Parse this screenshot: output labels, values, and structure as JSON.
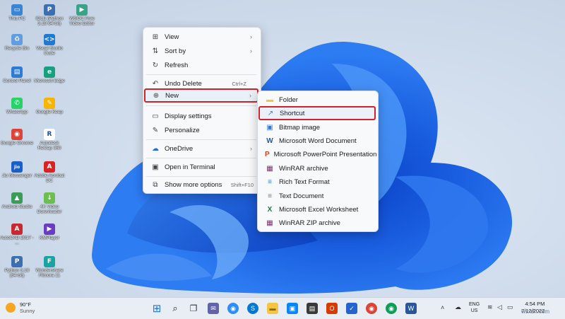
{
  "desktop_icons": [
    {
      "name": "this-pc",
      "label": "This PC",
      "color": "#3a86d6",
      "glyph": "▭"
    },
    {
      "name": "idle-python",
      "label": "IDLE (Python 3.10 64-bit)",
      "color": "#3b6fb0",
      "glyph": "P"
    },
    {
      "name": "wsoc-free-video",
      "label": "WSOC Free Video Editor",
      "color": "#3aa387",
      "glyph": "▶"
    },
    {
      "name": "recycle-bin",
      "label": "Recycle Bin",
      "color": "#5f9ee0",
      "glyph": "♻"
    },
    {
      "name": "visual-studio-code",
      "label": "Visual Studio Code",
      "color": "#1f7ad1",
      "glyph": "<>"
    },
    {
      "name": "control-panel",
      "label": "Control Panel",
      "color": "#2d7bd3",
      "glyph": "▤"
    },
    {
      "name": "microsoft-edge",
      "label": "Microsoft Edge",
      "color": "#17a07c",
      "glyph": "e"
    },
    {
      "name": "whatsapp",
      "label": "WhatsApp",
      "color": "#25d366",
      "glyph": "✆"
    },
    {
      "name": "google-keep",
      "label": "Google Keep",
      "color": "#f7b500",
      "glyph": "✎"
    },
    {
      "name": "google-chrome",
      "label": "Google Chrome",
      "color": "#db4437",
      "glyph": "◉"
    },
    {
      "name": "autodesk-recap",
      "label": "Autodesk ReCap 360",
      "color": "#ffffff",
      "glyph": "R"
    },
    {
      "name": "jio-messenger",
      "label": "Jio Messenger",
      "color": "#1a5fc8",
      "glyph": "jio"
    },
    {
      "name": "adobe-acrobat",
      "label": "Adobe Acrobat DC",
      "color": "#d92323",
      "glyph": "A"
    },
    {
      "name": "android-studio",
      "label": "Android Studio",
      "color": "#3b9c57",
      "glyph": "▲"
    },
    {
      "name": "4k-video-downloader",
      "label": "4K Video Downloader",
      "color": "#6cbe4f",
      "glyph": "↓"
    },
    {
      "name": "autocad",
      "label": "AutoCAD 2017 - ...",
      "color": "#c8282f",
      "glyph": "A"
    },
    {
      "name": "kmplayer",
      "label": "KMPlayer",
      "color": "#6a3cc1",
      "glyph": "▶"
    },
    {
      "name": "python-310",
      "label": "Python 3.10 (64-bit)",
      "color": "#3b6fb0",
      "glyph": "P"
    },
    {
      "name": "wondershare-filmora",
      "label": "Wondershare Filmora 11",
      "color": "#1aa3a3",
      "glyph": "F"
    }
  ],
  "context_menu": {
    "items": [
      {
        "name": "view",
        "label": "View",
        "icon": "grid-icon",
        "glyph": "⊞",
        "shortcut": "",
        "submenu": true
      },
      {
        "name": "sort-by",
        "label": "Sort by",
        "icon": "sort-icon",
        "glyph": "⇅",
        "shortcut": "",
        "submenu": true
      },
      {
        "name": "refresh",
        "label": "Refresh",
        "icon": "refresh-icon",
        "glyph": "↻",
        "shortcut": "",
        "submenu": false
      },
      {
        "name": "undo-delete",
        "label": "Undo Delete",
        "icon": "undo-icon",
        "glyph": "↶",
        "shortcut": "Ctrl+Z",
        "submenu": false
      },
      {
        "name": "new",
        "label": "New",
        "icon": "plus-circle-icon",
        "glyph": "⊕",
        "shortcut": "",
        "submenu": true
      },
      {
        "name": "display-settings",
        "label": "Display settings",
        "icon": "display-icon",
        "glyph": "▭",
        "shortcut": "",
        "submenu": false
      },
      {
        "name": "personalize",
        "label": "Personalize",
        "icon": "brush-icon",
        "glyph": "✎",
        "shortcut": "",
        "submenu": false
      },
      {
        "name": "onedrive",
        "label": "OneDrive",
        "icon": "cloud-icon",
        "glyph": "☁",
        "shortcut": "",
        "submenu": true
      },
      {
        "name": "open-in-terminal",
        "label": "Open in Terminal",
        "icon": "terminal-icon",
        "glyph": "▣",
        "shortcut": "",
        "submenu": false
      },
      {
        "name": "show-more-options",
        "label": "Show more options",
        "icon": "more-icon",
        "glyph": "⧉",
        "shortcut": "Shift+F10",
        "submenu": false
      }
    ]
  },
  "new_submenu": {
    "items": [
      {
        "name": "folder",
        "label": "Folder",
        "icon": "folder-icon",
        "glyph": "▬",
        "color": "#f4c542"
      },
      {
        "name": "shortcut",
        "label": "Shortcut",
        "icon": "shortcut-icon",
        "glyph": "↗",
        "color": "#3a7bd5"
      },
      {
        "name": "bitmap-image",
        "label": "Bitmap image",
        "icon": "bitmap-icon",
        "glyph": "▣",
        "color": "#2f7bd0"
      },
      {
        "name": "word-document",
        "label": "Microsoft Word Document",
        "icon": "word-icon",
        "glyph": "W",
        "color": "#2b579a"
      },
      {
        "name": "powerpoint-presentation",
        "label": "Microsoft PowerPoint Presentation",
        "icon": "powerpoint-icon",
        "glyph": "P",
        "color": "#d24726"
      },
      {
        "name": "winrar-archive",
        "label": "WinRAR archive",
        "icon": "winrar-icon",
        "glyph": "▦",
        "color": "#7a2d6f"
      },
      {
        "name": "rich-text-format",
        "label": "Rich Text Format",
        "icon": "rtf-icon",
        "glyph": "≡",
        "color": "#3a7bd5"
      },
      {
        "name": "text-document",
        "label": "Text Document",
        "icon": "text-icon",
        "glyph": "≡",
        "color": "#777777"
      },
      {
        "name": "excel-worksheet",
        "label": "Microsoft Excel Worksheet",
        "icon": "excel-icon",
        "glyph": "X",
        "color": "#217346"
      },
      {
        "name": "winrar-zip-archive",
        "label": "WinRAR ZIP archive",
        "icon": "winrar-zip-icon",
        "glyph": "▦",
        "color": "#7a2d6f"
      }
    ]
  },
  "taskbar": {
    "weather": {
      "temp": "90°F",
      "condition": "Sunny"
    },
    "apps": [
      {
        "name": "start",
        "color": "#1f6fd6",
        "glyph": "⊞"
      },
      {
        "name": "search",
        "color": "#333333",
        "glyph": "⌕"
      },
      {
        "name": "task-view",
        "color": "#444444",
        "glyph": "❐"
      },
      {
        "name": "chat",
        "color": "#6264a7",
        "glyph": "✉"
      },
      {
        "name": "zoom",
        "color": "#2d8cff",
        "glyph": "◉"
      },
      {
        "name": "skype",
        "color": "#0078d4",
        "glyph": "S"
      },
      {
        "name": "file-explorer",
        "color": "#f4c542",
        "glyph": "▬"
      },
      {
        "name": "photos",
        "color": "#0a84ff",
        "glyph": "▣"
      },
      {
        "name": "store",
        "color": "#3a3a3a",
        "glyph": "▤"
      },
      {
        "name": "office",
        "color": "#d83b01",
        "glyph": "O"
      },
      {
        "name": "todo",
        "color": "#2564cf",
        "glyph": "✓"
      },
      {
        "name": "chrome",
        "color": "#db4437",
        "glyph": "◉"
      },
      {
        "name": "chrome-profile",
        "color": "#0f9d58",
        "glyph": "◉"
      },
      {
        "name": "word",
        "color": "#2b579a",
        "glyph": "W"
      }
    ],
    "tray": {
      "lang1": "ENG",
      "lang2": "US",
      "time": "4:54 PM",
      "date": "7/12/2022"
    }
  },
  "watermark": "wsxdn.com"
}
